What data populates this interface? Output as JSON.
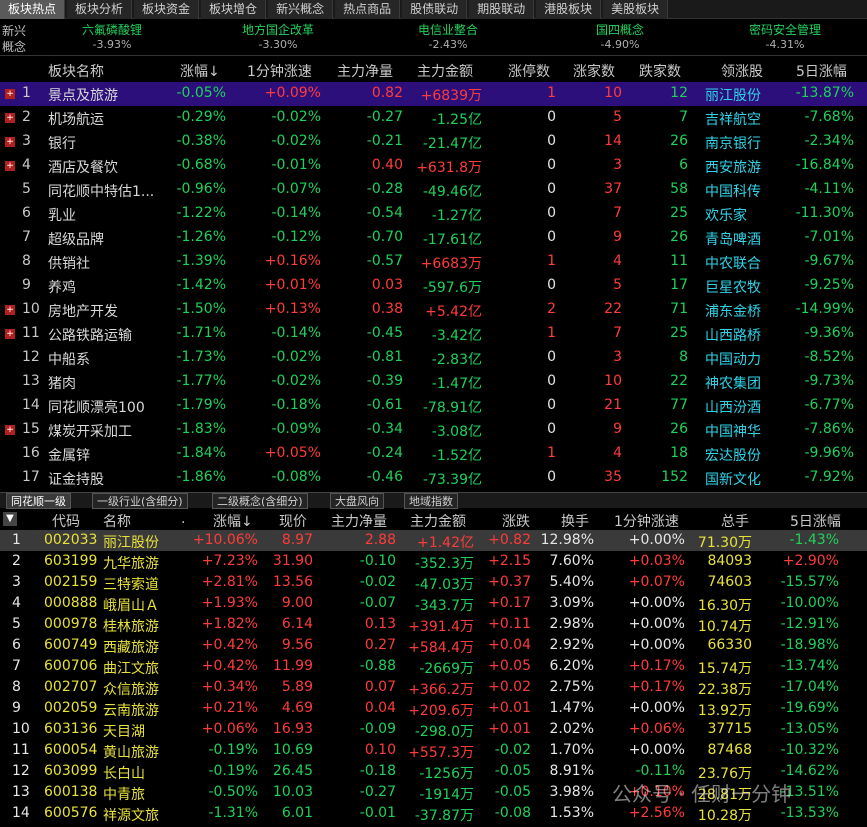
{
  "top_tabs": [
    "板块热点",
    "板块分析",
    "板块资金",
    "板块增仓",
    "新兴概念",
    "热点商品",
    "股债联动",
    "期股联动",
    "港股板块",
    "美股板块"
  ],
  "concepts": {
    "label": "新兴概念",
    "items": [
      {
        "name": "六氟磷酸锂",
        "pct": "-3.93%"
      },
      {
        "name": "地方国企改革",
        "pct": "-3.30%"
      },
      {
        "name": "电信业整合",
        "pct": "-2.43%"
      },
      {
        "name": "国四概念",
        "pct": "-4.90%"
      },
      {
        "name": "密码安全管理",
        "pct": "-4.31%"
      }
    ]
  },
  "upper_table": {
    "headers": {
      "name": "板块名称",
      "chg": "涨幅",
      "sort_icon": "↓",
      "speed": "1分钟涨速",
      "net": "主力净量",
      "amount": "主力金额",
      "limit": "涨停数",
      "up": "涨家数",
      "down": "跌家数",
      "leader": "领涨股",
      "d5": "5日涨幅"
    },
    "rows": [
      {
        "idx": "1",
        "name": "景点及旅游",
        "chg": "-0.05%",
        "speed": "+0.09%",
        "net": "0.82",
        "amount": "+6839万",
        "limit": "1",
        "up": "10",
        "down": "12",
        "leader": "丽江股份",
        "d5": "-13.87%",
        "exp": true
      },
      {
        "idx": "2",
        "name": "机场航运",
        "chg": "-0.29%",
        "speed": "-0.02%",
        "net": "-0.27",
        "amount": "-1.25亿",
        "limit": "0",
        "up": "5",
        "down": "7",
        "leader": "吉祥航空",
        "d5": "-7.68%",
        "exp": true
      },
      {
        "idx": "3",
        "name": "银行",
        "chg": "-0.38%",
        "speed": "-0.02%",
        "net": "-0.21",
        "amount": "-21.47亿",
        "limit": "0",
        "up": "14",
        "down": "26",
        "leader": "南京银行",
        "d5": "-2.34%",
        "exp": true
      },
      {
        "idx": "4",
        "name": "酒店及餐饮",
        "chg": "-0.68%",
        "speed": "-0.01%",
        "net": "0.40",
        "amount": "+631.8万",
        "limit": "0",
        "up": "3",
        "down": "6",
        "leader": "西安旅游",
        "d5": "-16.84%",
        "exp": true
      },
      {
        "idx": "5",
        "name": "同花顺中特估1...",
        "chg": "-0.96%",
        "speed": "-0.07%",
        "net": "-0.28",
        "amount": "-49.46亿",
        "limit": "0",
        "up": "37",
        "down": "58",
        "leader": "中国科传",
        "d5": "-4.11%",
        "exp": false
      },
      {
        "idx": "6",
        "name": "乳业",
        "chg": "-1.22%",
        "speed": "-0.14%",
        "net": "-0.54",
        "amount": "-1.27亿",
        "limit": "0",
        "up": "7",
        "down": "25",
        "leader": "欢乐家",
        "d5": "-11.30%",
        "exp": false
      },
      {
        "idx": "7",
        "name": "超级品牌",
        "chg": "-1.26%",
        "speed": "-0.12%",
        "net": "-0.70",
        "amount": "-17.61亿",
        "limit": "0",
        "up": "9",
        "down": "26",
        "leader": "青岛啤酒",
        "d5": "-7.01%",
        "exp": false
      },
      {
        "idx": "8",
        "name": "供销社",
        "chg": "-1.39%",
        "speed": "+0.16%",
        "net": "-0.57",
        "amount": "+6683万",
        "limit": "1",
        "up": "4",
        "down": "11",
        "leader": "中农联合",
        "d5": "-9.67%",
        "exp": false
      },
      {
        "idx": "9",
        "name": "养鸡",
        "chg": "-1.42%",
        "speed": "+0.01%",
        "net": "0.03",
        "amount": "-597.6万",
        "limit": "0",
        "up": "5",
        "down": "17",
        "leader": "巨星农牧",
        "d5": "-9.25%",
        "exp": false
      },
      {
        "idx": "10",
        "name": "房地产开发",
        "chg": "-1.50%",
        "speed": "+0.13%",
        "net": "0.38",
        "amount": "+5.42亿",
        "limit": "2",
        "up": "22",
        "down": "71",
        "leader": "浦东金桥",
        "d5": "-14.99%",
        "exp": true
      },
      {
        "idx": "11",
        "name": "公路铁路运输",
        "chg": "-1.71%",
        "speed": "-0.14%",
        "net": "-0.45",
        "amount": "-3.42亿",
        "limit": "1",
        "up": "7",
        "down": "25",
        "leader": "山西路桥",
        "d5": "-9.36%",
        "exp": true
      },
      {
        "idx": "12",
        "name": "中船系",
        "chg": "-1.73%",
        "speed": "-0.02%",
        "net": "-0.81",
        "amount": "-2.83亿",
        "limit": "0",
        "up": "3",
        "down": "8",
        "leader": "中国动力",
        "d5": "-8.52%",
        "exp": false
      },
      {
        "idx": "13",
        "name": "猪肉",
        "chg": "-1.77%",
        "speed": "-0.02%",
        "net": "-0.39",
        "amount": "-1.47亿",
        "limit": "0",
        "up": "10",
        "down": "22",
        "leader": "神农集团",
        "d5": "-9.73%",
        "exp": false
      },
      {
        "idx": "14",
        "name": "同花顺漂亮100",
        "chg": "-1.79%",
        "speed": "-0.18%",
        "net": "-0.61",
        "amount": "-78.91亿",
        "limit": "0",
        "up": "21",
        "down": "77",
        "leader": "山西汾酒",
        "d5": "-6.77%",
        "exp": false
      },
      {
        "idx": "15",
        "name": "煤炭开采加工",
        "chg": "-1.83%",
        "speed": "-0.09%",
        "net": "-0.34",
        "amount": "-3.08亿",
        "limit": "0",
        "up": "9",
        "down": "26",
        "leader": "中国神华",
        "d5": "-7.86%",
        "exp": true
      },
      {
        "idx": "16",
        "name": "金属锌",
        "chg": "-1.84%",
        "speed": "+0.05%",
        "net": "-0.24",
        "amount": "-1.52亿",
        "limit": "1",
        "up": "4",
        "down": "18",
        "leader": "宏达股份",
        "d5": "-9.96%",
        "exp": false
      },
      {
        "idx": "17",
        "name": "证金持股",
        "chg": "-1.86%",
        "speed": "-0.08%",
        "net": "-0.46",
        "amount": "-73.39亿",
        "limit": "0",
        "up": "35",
        "down": "152",
        "leader": "国新文化",
        "d5": "-7.92%",
        "exp": false
      }
    ]
  },
  "divider_tabs": [
    "同花顺一级",
    "一级行业(含细分)",
    "二级概念(含细分)",
    "大盘风向",
    "地域指数"
  ],
  "lower_table": {
    "headers": {
      "code": "代码",
      "name": "名称",
      "dot": ".",
      "chg": "涨幅",
      "sort_icon": "↓",
      "price": "现价",
      "net": "主力净量",
      "amount": "主力金额",
      "change": "涨跌",
      "turnover": "换手",
      "speed": "1分钟涨速",
      "vol": "总手",
      "d5": "5日涨幅"
    },
    "rows": [
      {
        "idx": "1",
        "code": "002033",
        "name": "丽江股份",
        "chg": "+10.06%",
        "price": "8.97",
        "net": "2.88",
        "amount": "+1.42亿",
        "change": "+0.82",
        "turnover": "12.98%",
        "speed": "+0.00%",
        "vol": "71.30万",
        "d5": "-1.43%"
      },
      {
        "idx": "2",
        "code": "603199",
        "name": "九华旅游",
        "chg": "+7.23%",
        "price": "31.90",
        "net": "-0.10",
        "amount": "-352.3万",
        "change": "+2.15",
        "turnover": "7.60%",
        "speed": "+0.03%",
        "vol": "84093",
        "d5": "+2.90%"
      },
      {
        "idx": "3",
        "code": "002159",
        "name": "三特索道",
        "chg": "+2.81%",
        "price": "13.56",
        "net": "-0.02",
        "amount": "-47.03万",
        "change": "+0.37",
        "turnover": "5.40%",
        "speed": "+0.07%",
        "vol": "74603",
        "d5": "-15.57%"
      },
      {
        "idx": "4",
        "code": "000888",
        "name": "峨眉山Ａ",
        "chg": "+1.93%",
        "price": "9.00",
        "net": "-0.07",
        "amount": "-343.7万",
        "change": "+0.17",
        "turnover": "3.09%",
        "speed": "+0.00%",
        "vol": "16.30万",
        "d5": "-10.00%"
      },
      {
        "idx": "5",
        "code": "000978",
        "name": "桂林旅游",
        "chg": "+1.82%",
        "price": "6.14",
        "net": "0.13",
        "amount": "+391.4万",
        "change": "+0.11",
        "turnover": "2.98%",
        "speed": "+0.00%",
        "vol": "10.74万",
        "d5": "-12.91%"
      },
      {
        "idx": "6",
        "code": "600749",
        "name": "西藏旅游",
        "chg": "+0.42%",
        "price": "9.56",
        "net": "0.27",
        "amount": "+584.4万",
        "change": "+0.04",
        "turnover": "2.92%",
        "speed": "+0.00%",
        "vol": "66330",
        "d5": "-18.98%"
      },
      {
        "idx": "7",
        "code": "600706",
        "name": "曲江文旅",
        "chg": "+0.42%",
        "price": "11.99",
        "net": "-0.88",
        "amount": "-2669万",
        "change": "+0.05",
        "turnover": "6.20%",
        "speed": "+0.17%",
        "vol": "15.74万",
        "d5": "-13.74%"
      },
      {
        "idx": "8",
        "code": "002707",
        "name": "众信旅游",
        "chg": "+0.34%",
        "price": "5.89",
        "net": "0.07",
        "amount": "+366.2万",
        "change": "+0.02",
        "turnover": "2.75%",
        "speed": "+0.17%",
        "vol": "22.38万",
        "d5": "-17.04%"
      },
      {
        "idx": "9",
        "code": "002059",
        "name": "云南旅游",
        "chg": "+0.21%",
        "price": "4.69",
        "net": "0.04",
        "amount": "+209.6万",
        "change": "+0.01",
        "turnover": "1.47%",
        "speed": "+0.00%",
        "vol": "13.92万",
        "d5": "-19.69%"
      },
      {
        "idx": "10",
        "code": "603136",
        "name": "天目湖",
        "chg": "+0.06%",
        "price": "16.93",
        "net": "-0.09",
        "amount": "-298.0万",
        "change": "+0.01",
        "turnover": "2.02%",
        "speed": "+0.06%",
        "vol": "37715",
        "d5": "-13.05%"
      },
      {
        "idx": "11",
        "code": "600054",
        "name": "黄山旅游",
        "chg": "-0.19%",
        "price": "10.69",
        "net": "0.10",
        "amount": "+557.3万",
        "change": "-0.02",
        "turnover": "1.70%",
        "speed": "+0.00%",
        "vol": "87468",
        "d5": "-10.32%"
      },
      {
        "idx": "12",
        "code": "603099",
        "name": "长白山",
        "chg": "-0.19%",
        "price": "26.45",
        "net": "-0.18",
        "amount": "-1256万",
        "change": "-0.05",
        "turnover": "8.91%",
        "speed": "-0.11%",
        "vol": "23.76万",
        "d5": "-14.62%"
      },
      {
        "idx": "13",
        "code": "600138",
        "name": "中青旅",
        "chg": "-0.50%",
        "price": "10.03",
        "net": "-0.27",
        "amount": "-1914万",
        "change": "-0.05",
        "turnover": "3.98%",
        "speed": "+0.10%",
        "vol": "28.81万",
        "d5": "-13.51%"
      },
      {
        "idx": "14",
        "code": "600576",
        "name": "祥源文旅",
        "chg": "-1.31%",
        "price": "6.01",
        "net": "-0.01",
        "amount": "-37.87万",
        "change": "-0.08",
        "turnover": "1.53%",
        "speed": "+2.56%",
        "vol": "10.28万",
        "d5": "-13.53%"
      }
    ]
  },
  "watermark": "公众号 · 任财一分钟",
  "colors": {
    "up": "#ff3b3b",
    "down": "#1fd15b",
    "highlight": "#2c0f7a",
    "leader": "#2fd3e8",
    "code": "#e8e13a"
  }
}
